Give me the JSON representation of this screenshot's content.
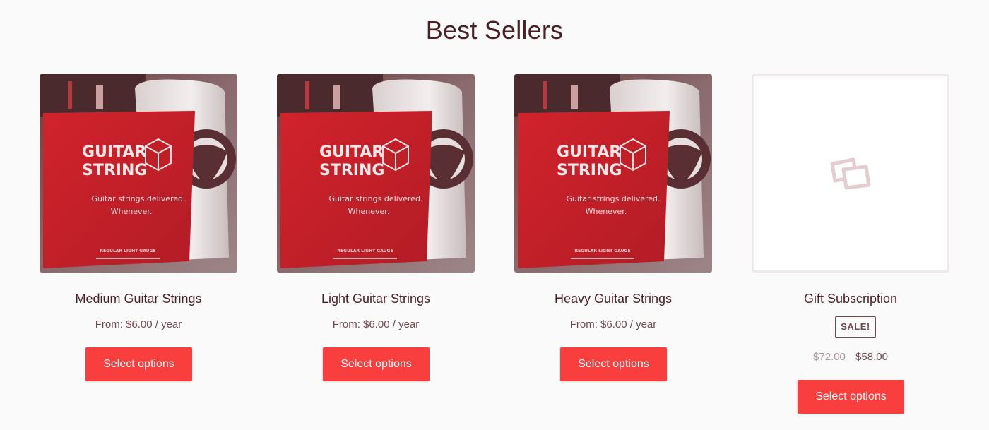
{
  "page": {
    "title": "Best Sellers"
  },
  "products": [
    {
      "name": "Medium Guitar Strings",
      "price": "From: $6.00 / year",
      "button_label": "Select options",
      "image_text": {
        "brand_line1": "GUITAR",
        "brand_line2": "STRING",
        "tagline1": "Guitar strings delivered.",
        "tagline2": "Whenever.",
        "gauge": "REGULAR LIGHT GAUGE"
      }
    },
    {
      "name": "Light Guitar Strings",
      "price": "From: $6.00 / year",
      "button_label": "Select options",
      "image_text": {
        "brand_line1": "GUITAR",
        "brand_line2": "STRING",
        "tagline1": "Guitar strings delivered.",
        "tagline2": "Whenever.",
        "gauge": "REGULAR LIGHT GAUGE"
      }
    },
    {
      "name": "Heavy Guitar Strings",
      "price": "From: $6.00 / year",
      "button_label": "Select options",
      "image_text": {
        "brand_line1": "GUITAR",
        "brand_line2": "STRING",
        "tagline1": "Guitar strings delivered.",
        "tagline2": "Whenever.",
        "gauge": "REGULAR LIGHT GAUGE"
      }
    },
    {
      "name": "Gift Subscription",
      "sale_badge": "SALE!",
      "old_price": "$72.00",
      "new_price": "$58.00",
      "button_label": "Select options"
    }
  ],
  "colors": {
    "accent": "#f93e3e",
    "text": "#4a1e25",
    "muted": "#6e4a50",
    "package_red": "#c8202a"
  }
}
